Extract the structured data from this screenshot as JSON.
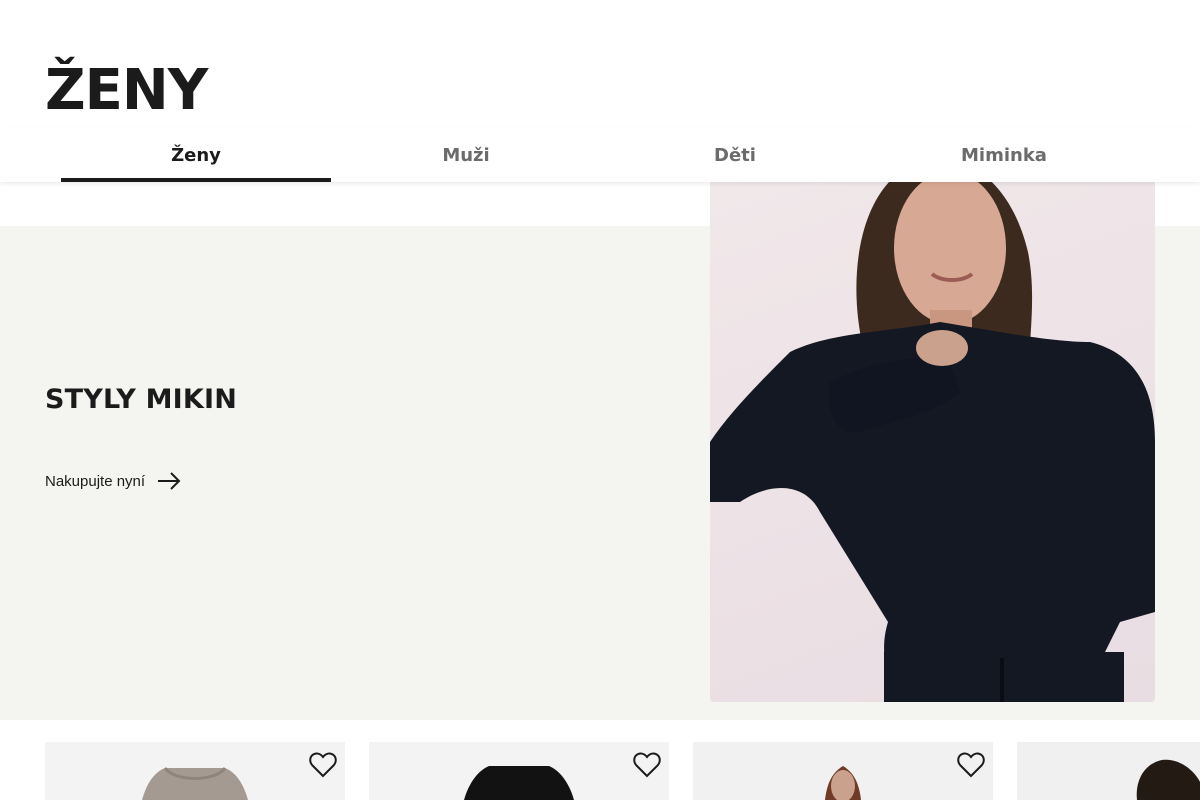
{
  "page": {
    "title": "ŽENY"
  },
  "tabs": [
    {
      "label": "Ženy",
      "active": true
    },
    {
      "label": "Muži",
      "active": false
    },
    {
      "label": "Děti",
      "active": false
    },
    {
      "label": "Miminka",
      "active": false
    }
  ],
  "hero": {
    "title": "STYLY MIKIN",
    "cta_label": "Nakupujte nyní",
    "cta_icon": "arrow-right-icon",
    "background_color": "#f4f4f0"
  },
  "products": [
    {
      "item": "taupe hoodie",
      "wishlist_icon": "heart-icon"
    },
    {
      "item": "black hoodie",
      "wishlist_icon": "heart-icon"
    },
    {
      "item": "woman model",
      "wishlist_icon": "heart-icon"
    },
    {
      "item": "man model",
      "wishlist_icon": "heart-icon"
    }
  ],
  "colors": {
    "text": "#1b1b1b",
    "muted": "#6b6b6b",
    "accent_underline": "#1b1b1b"
  }
}
